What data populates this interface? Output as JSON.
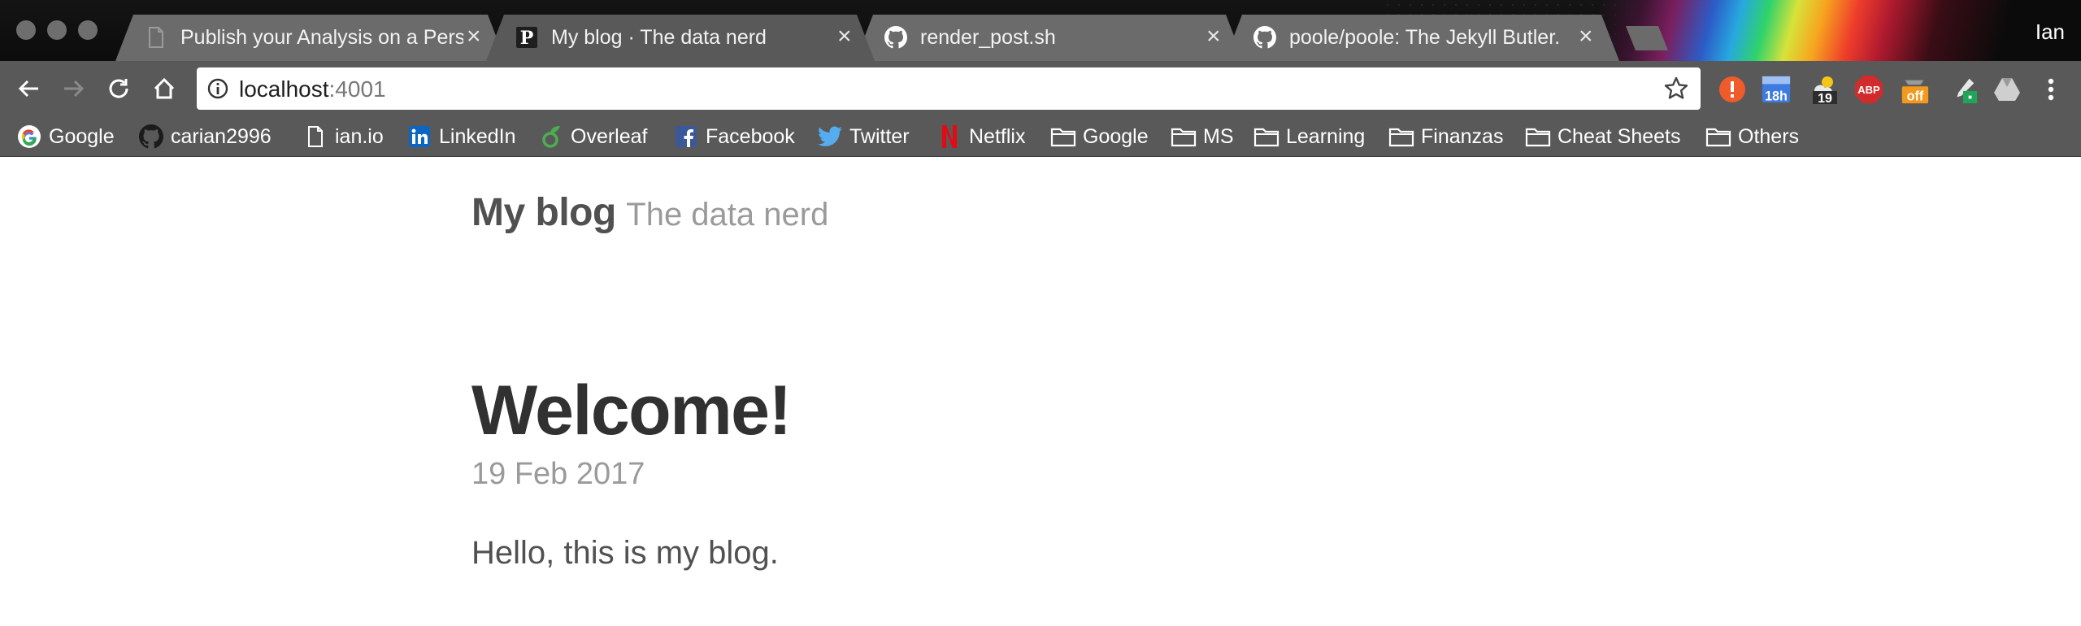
{
  "window": {
    "profile_name": "Ian"
  },
  "tabs": [
    {
      "title": "Publish your Analysis on a Pers",
      "icon": "page-icon",
      "active": false
    },
    {
      "title": "My blog · The data nerd",
      "icon": "p-favicon-icon",
      "active": true
    },
    {
      "title": "render_post.sh",
      "icon": "github-icon",
      "active": false
    },
    {
      "title": "poole/poole: The Jekyll Butler.",
      "icon": "github-icon",
      "active": false
    }
  ],
  "toolbar": {
    "url_host": "localhost",
    "url_port": ":4001",
    "extensions": [
      {
        "name": "alert-extension-icon",
        "color": "#ef5b2a"
      },
      {
        "name": "calendar-extension-icon",
        "badge": "18h",
        "color": "#3d7be0"
      },
      {
        "name": "weather-extension-icon",
        "badge": "19",
        "color": "#333333"
      },
      {
        "name": "adblock-extension-icon",
        "badge": "ABP",
        "color": "#d22b2b"
      },
      {
        "name": "off-extension-icon",
        "badge": "off",
        "color": "#f39a1e"
      },
      {
        "name": "eyedropper-extension-icon",
        "color": "#1fa55a"
      },
      {
        "name": "google-drive-extension-icon",
        "color": "#d0d0d0"
      }
    ]
  },
  "bookmarks": [
    {
      "label": "Google",
      "icon": "google-icon"
    },
    {
      "label": "carian2996",
      "icon": "github-icon"
    },
    {
      "label": "ian.io",
      "icon": "page-icon"
    },
    {
      "label": "LinkedIn",
      "icon": "linkedin-icon"
    },
    {
      "label": "Overleaf",
      "icon": "overleaf-icon"
    },
    {
      "label": "Facebook",
      "icon": "facebook-icon"
    },
    {
      "label": "Twitter",
      "icon": "twitter-icon"
    },
    {
      "label": "Netflix",
      "icon": "netflix-icon"
    },
    {
      "label": "Google",
      "icon": "folder-icon"
    },
    {
      "label": "MS",
      "icon": "folder-icon"
    },
    {
      "label": "Learning",
      "icon": "folder-icon"
    },
    {
      "label": "Finanzas",
      "icon": "folder-icon"
    },
    {
      "label": "Cheat Sheets",
      "icon": "folder-icon"
    },
    {
      "label": "Others",
      "icon": "folder-icon"
    }
  ],
  "page": {
    "site_title": "My blog",
    "site_tagline": "The data nerd",
    "post_title": "Welcome!",
    "post_date": "19 Feb 2017",
    "post_body": "Hello, this is my blog."
  }
}
